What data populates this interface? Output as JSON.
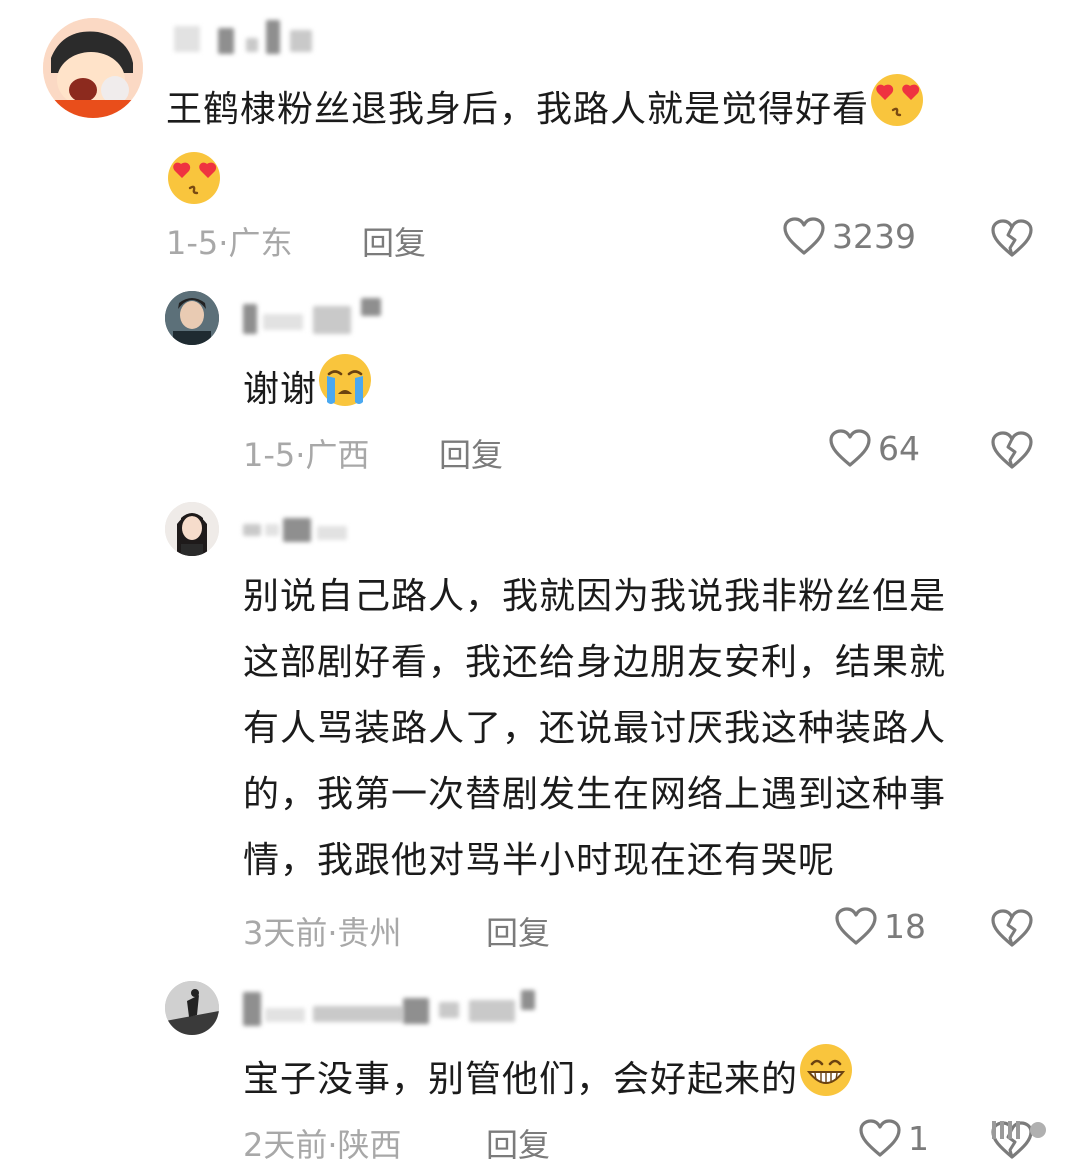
{
  "comments": [
    {
      "text_lines": [
        "王鹤棣粉丝退我身后，我路人就是觉得好看"
      ],
      "emoji_inline": "heart-eyes-emoji",
      "emoji_next_line": "kissing-heart-emoji",
      "date": "1-5",
      "separator": "·",
      "location": "广东",
      "reply_label": "回复",
      "likes": "3239"
    },
    {
      "text_lines": [
        "谢谢"
      ],
      "emoji_inline": "crying-emoji",
      "date": "1-5",
      "separator": "·",
      "location": "广西",
      "reply_label": "回复",
      "likes": "64"
    },
    {
      "text_lines": [
        "别说自己路人，我就因为我说我非粉丝但是",
        "这部剧好看，我还给身边朋友安利，结果就",
        "有人骂装路人了，还说最讨厌我这种装路人",
        "的，我第一次替剧发生在网络上遇到这种事",
        "情，我跟他对骂半小时现在还有哭呢"
      ],
      "date": "3天前",
      "separator": "·",
      "location": "贵州",
      "reply_label": "回复",
      "likes": "18"
    },
    {
      "text_lines": [
        "宝子没事，别管他们，会好起来的"
      ],
      "emoji_inline": "grinning-emoji",
      "date": "2天前",
      "separator": "·",
      "location": "陕西",
      "reply_label": "回复",
      "likes": "1"
    }
  ],
  "colors": {
    "text": "#1b1b1b",
    "meta": "#a8a8a8",
    "action": "#7b7b7b"
  }
}
